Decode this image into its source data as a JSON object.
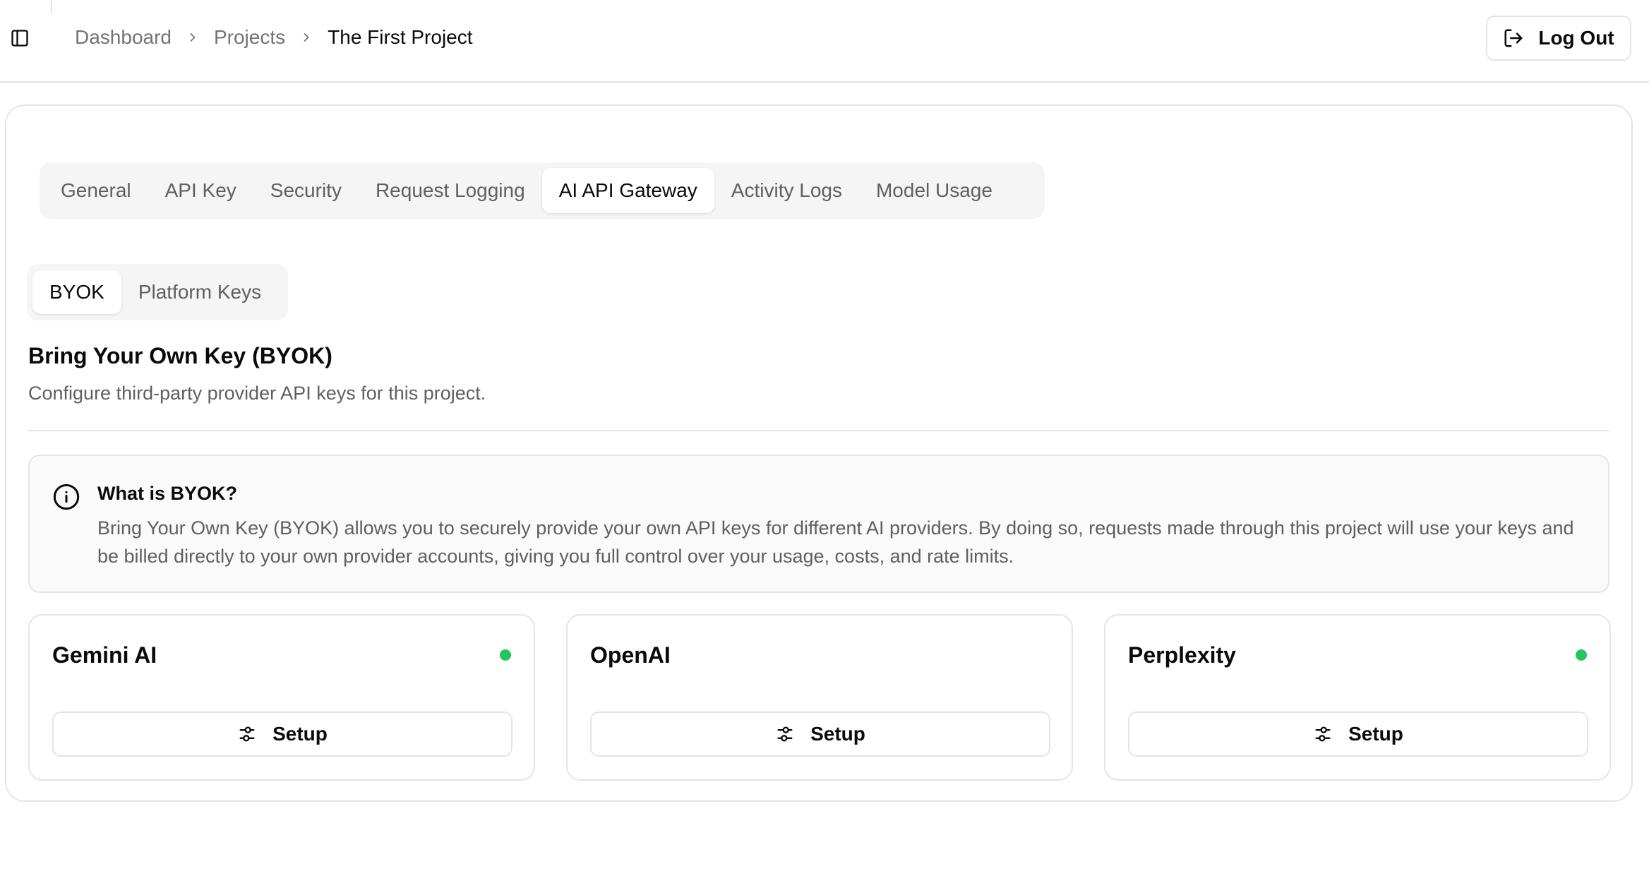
{
  "header": {
    "breadcrumb": [
      "Dashboard",
      "Projects",
      "The First Project"
    ],
    "logout_label": "Log Out"
  },
  "tabs": [
    {
      "label": "General",
      "active": false
    },
    {
      "label": "API Key",
      "active": false
    },
    {
      "label": "Security",
      "active": false
    },
    {
      "label": "Request Logging",
      "active": false
    },
    {
      "label": "AI API Gateway",
      "active": true
    },
    {
      "label": "Activity Logs",
      "active": false
    },
    {
      "label": "Model Usage",
      "active": false
    }
  ],
  "subtabs": [
    {
      "label": "BYOK",
      "active": true
    },
    {
      "label": "Platform Keys",
      "active": false
    }
  ],
  "section": {
    "title": "Bring Your Own Key (BYOK)",
    "description": "Configure third-party provider API keys for this project."
  },
  "info": {
    "title": "What is BYOK?",
    "text": "Bring Your Own Key (BYOK) allows you to securely provide your own API keys for different AI providers. By doing so, requests made through this project will use your keys and be billed directly to your own provider accounts, giving you full control over your usage, costs, and rate limits."
  },
  "providers": [
    {
      "name": "Gemini AI",
      "configured": true,
      "setup_label": "Setup"
    },
    {
      "name": "OpenAI",
      "configured": false,
      "setup_label": "Setup"
    },
    {
      "name": "Perplexity",
      "configured": true,
      "setup_label": "Setup"
    }
  ],
  "colors": {
    "status_active": "#22c55e",
    "muted_text": "#5f5f5f",
    "border": "#e5e5e5"
  },
  "icons": {
    "sidebar_toggle": "panel-left-icon",
    "breadcrumb_separator": "chevron-right-icon",
    "logout": "log-out-icon",
    "info": "info-icon",
    "setup": "sliders-icon"
  }
}
